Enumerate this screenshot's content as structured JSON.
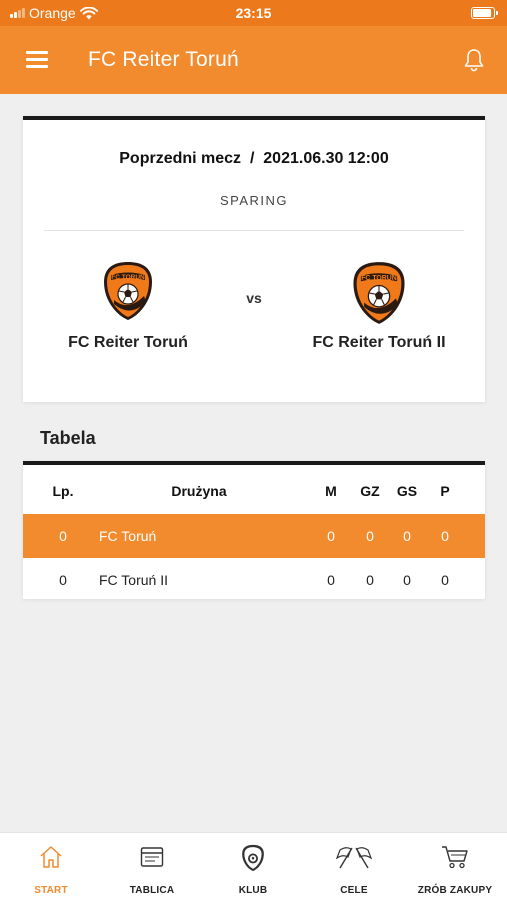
{
  "status_bar": {
    "carrier": "Orange",
    "time": "23:15",
    "icons": [
      "signal-icon",
      "wifi-icon",
      "battery-icon"
    ]
  },
  "app_bar": {
    "title": "FC Reiter Toruń",
    "icons": [
      "menu-icon",
      "bell-icon"
    ]
  },
  "match": {
    "header": "Poprzedni mecz  /  2021.06.30 12:00",
    "type": "SPARING",
    "vs": "vs",
    "home_team": "FC Reiter Toruń",
    "away_team": "FC Reiter Toruń II",
    "logo_text": "FC TORUŃ"
  },
  "table": {
    "title": "Tabela",
    "headers": {
      "lp": "Lp.",
      "team": "Drużyna",
      "m": "M",
      "gz": "GZ",
      "gs": "GS",
      "p": "P"
    },
    "rows": [
      {
        "lp": "0",
        "team": "FC Toruń",
        "m": "0",
        "gz": "0",
        "gs": "0",
        "p": "0",
        "highlighted": true
      },
      {
        "lp": "0",
        "team": "FC Toruń II",
        "m": "0",
        "gz": "0",
        "gs": "0",
        "p": "0",
        "highlighted": false
      }
    ]
  },
  "bottom_nav": {
    "items": [
      {
        "label": "START",
        "icon": "home-icon",
        "active": true
      },
      {
        "label": "TABLICA",
        "icon": "board-icon",
        "active": false
      },
      {
        "label": "KLUB",
        "icon": "club-crest-icon",
        "active": false
      },
      {
        "label": "CELE",
        "icon": "flags-icon",
        "active": false
      },
      {
        "label": "ZRÓB ZAKUPY",
        "icon": "cart-icon",
        "active": false
      }
    ]
  },
  "colors": {
    "primary": "#f28a2e",
    "status_bar": "#ec7a1c",
    "background": "#efefef",
    "card_top_border": "#1a1a1a"
  }
}
